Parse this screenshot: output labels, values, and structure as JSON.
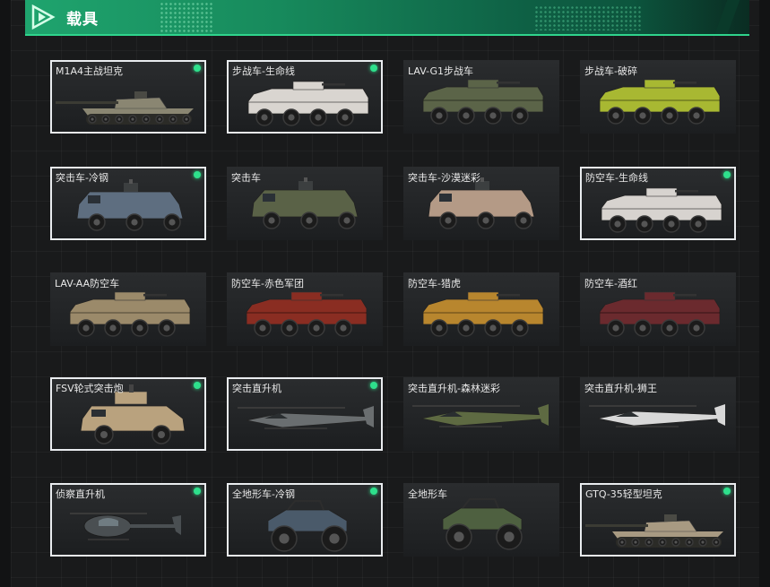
{
  "header": {
    "title": "载具"
  },
  "vehicles": [
    {
      "name": "M1A4主战坦克",
      "selected": true,
      "owned": true,
      "kind": "tank",
      "color": "#8a8672"
    },
    {
      "name": "步战车-生命线",
      "selected": true,
      "owned": true,
      "kind": "apc",
      "color": "#d9d5d0"
    },
    {
      "name": "LAV-G1步战车",
      "selected": false,
      "owned": false,
      "kind": "apc",
      "color": "#5b6448"
    },
    {
      "name": "步战车-破碎",
      "selected": false,
      "owned": false,
      "kind": "apc",
      "color": "#a8b832"
    },
    {
      "name": "突击车-冷钢",
      "selected": true,
      "owned": true,
      "kind": "mrap",
      "color": "#5e6e80"
    },
    {
      "name": "突击车",
      "selected": false,
      "owned": false,
      "kind": "mrap",
      "color": "#5a6247"
    },
    {
      "name": "突击车-沙漠迷彩",
      "selected": false,
      "owned": false,
      "kind": "mrap",
      "color": "#b49a86"
    },
    {
      "name": "防空车-生命线",
      "selected": true,
      "owned": true,
      "kind": "apc",
      "color": "#d7d3cf"
    },
    {
      "name": "LAV-AA防空车",
      "selected": false,
      "owned": false,
      "kind": "apc",
      "color": "#9b8a6a"
    },
    {
      "name": "防空车-赤色军团",
      "selected": false,
      "owned": false,
      "kind": "apc",
      "color": "#8a2d22"
    },
    {
      "name": "防空车-猎虎",
      "selected": false,
      "owned": false,
      "kind": "apc",
      "color": "#b8862e"
    },
    {
      "name": "防空车-酒红",
      "selected": false,
      "owned": false,
      "kind": "apc",
      "color": "#6b2a2e"
    },
    {
      "name": "FSV轮式突击炮",
      "selected": true,
      "owned": true,
      "kind": "fsv",
      "color": "#b9a27e"
    },
    {
      "name": "突击直升机",
      "selected": true,
      "owned": true,
      "kind": "heli",
      "color": "#6a6e70"
    },
    {
      "name": "突击直升机-森林迷彩",
      "selected": false,
      "owned": false,
      "kind": "heli",
      "color": "#5e6a42"
    },
    {
      "name": "突击直升机-狮王",
      "selected": false,
      "owned": false,
      "kind": "heli",
      "color": "#d8d8d8"
    },
    {
      "name": "侦察直升机",
      "selected": true,
      "owned": true,
      "kind": "scout",
      "color": "#4a4f52"
    },
    {
      "name": "全地形车-冷钢",
      "selected": true,
      "owned": true,
      "kind": "atv",
      "color": "#4a5a6a"
    },
    {
      "name": "全地形车",
      "selected": false,
      "owned": false,
      "kind": "atv",
      "color": "#4e6040"
    },
    {
      "name": "GTQ-35轻型坦克",
      "selected": true,
      "owned": true,
      "kind": "tank",
      "color": "#a89a82"
    }
  ]
}
